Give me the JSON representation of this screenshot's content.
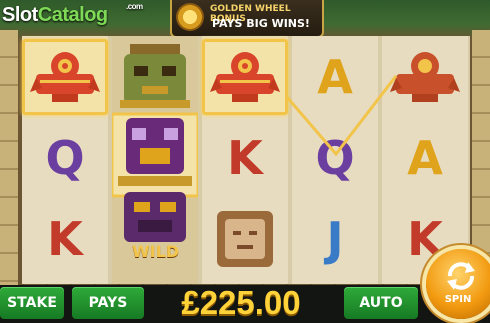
{
  "brand": {
    "logo_text_a": "Slot",
    "logo_text_b": "Catalog",
    "logo_suffix": ".com"
  },
  "banner": {
    "line1": "GOLDEN WHEEL BONUS",
    "line2": "PAYS BIG WINS!"
  },
  "reels": [
    [
      "bird",
      "Q",
      "K"
    ],
    [
      "totem",
      "totem",
      "wild-totem"
    ],
    [
      "bird",
      "K",
      "stone-face"
    ],
    [
      "A",
      "Q",
      "J"
    ],
    [
      "bird",
      "A",
      "K"
    ]
  ],
  "wild_label": "WILD",
  "letter_colors": {
    "A": "#e0a31c",
    "K": "#c23a2a",
    "Q": "#6b3fa0",
    "J": "#3a7bc8"
  },
  "highlighted_cells": [
    "r1c1",
    "r1c2",
    "r1c3"
  ],
  "controls": {
    "stake": "STAKE",
    "pays": "PAYS",
    "auto": "AUTO",
    "spin": "SPIN"
  },
  "win_amount": "£225.00",
  "colors": {
    "accent_gold": "#ffd23a",
    "button_green": "#1f9a2d",
    "payline": "#f2c44a"
  }
}
